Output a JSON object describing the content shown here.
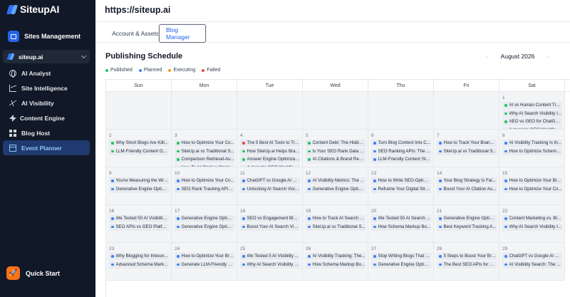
{
  "sidebar": {
    "logo": "SiteupAI",
    "section": "Sites Management",
    "site": "siteup.ai",
    "nav": [
      {
        "label": "AI Analyst",
        "icon": "globe-icon"
      },
      {
        "label": "Site Intelligence",
        "icon": "chart-icon"
      },
      {
        "label": "AI Visibility",
        "icon": "pulse-icon"
      },
      {
        "label": "Content Engine",
        "icon": "bolt-icon"
      },
      {
        "label": "Blog Host",
        "icon": "grid-icon"
      },
      {
        "label": "Event Planner",
        "icon": "calendar-icon",
        "active": true
      }
    ],
    "quick_start": "Quick Start"
  },
  "header": {
    "url": "https://siteup.ai"
  },
  "tabs": [
    {
      "label": "Account & Assets"
    },
    {
      "label": "Blog Manager",
      "active": true
    }
  ],
  "schedule": {
    "title": "Publishing Schedule",
    "month": "August 2026",
    "prev": "‹",
    "next": "›",
    "legend": [
      {
        "label": "Published",
        "color": "#22c55e"
      },
      {
        "label": "Planned",
        "color": "#3b82f6"
      },
      {
        "label": "Executing",
        "color": "#f59e0b"
      },
      {
        "label": "Failed",
        "color": "#ef4444"
      }
    ],
    "weekdays": [
      "Sun",
      "Mon",
      "Tue",
      "Wed",
      "Thu",
      "Fri",
      "Sat"
    ],
    "colors": {
      "published": "#22c55e",
      "planned": "#3b82f6",
      "failed": "#ef4444"
    },
    "weeks": [
      [
        {
          "day": "",
          "events": []
        },
        {
          "day": "",
          "events": []
        },
        {
          "day": "",
          "events": []
        },
        {
          "day": "",
          "events": []
        },
        {
          "day": "",
          "events": []
        },
        {
          "day": "",
          "events": []
        },
        {
          "day": "1",
          "events": [
            {
              "title": "AI vs Human Content Tru...",
              "status": "published"
            },
            {
              "title": "Why AI Search Visibility I...",
              "status": "published"
            },
            {
              "title": "AEO vs GEO for ChatGPT ...",
              "status": "published"
            },
            {
              "title": "Automatic GEO Workflow...",
              "status": "published"
            }
          ]
        }
      ],
      [
        {
          "day": "2",
          "events": [
            {
              "title": "Why Short Blogs Are Killi...",
              "status": "published"
            },
            {
              "title": "LLM-Friendly Content Opt...",
              "status": "published"
            }
          ]
        },
        {
          "day": "3",
          "events": [
            {
              "title": "How to Optimize Your Co...",
              "status": "published"
            },
            {
              "title": "SiteUp.ai vs Traditional S...",
              "status": "published"
            },
            {
              "title": "Comparison Retrieval-Au...",
              "status": "published"
            },
            {
              "title": "How To AI Citation Strate...",
              "status": "published"
            }
          ]
        },
        {
          "day": "4",
          "events": [
            {
              "title": "The 5 Best AI Tools to Tra...",
              "status": "failed"
            },
            {
              "title": "How SiteUp.ai Helps Bran...",
              "status": "published"
            },
            {
              "title": "Answer Engine Optimizati...",
              "status": "published"
            },
            {
              "title": "Automatic GEO Workflow...",
              "status": "published"
            }
          ]
        },
        {
          "day": "5",
          "events": [
            {
              "title": "Content Debt: The Hidden...",
              "status": "published"
            },
            {
              "title": "Is Your SEO Rank Data Ac...",
              "status": "published"
            },
            {
              "title": "AI Citations & Brand Reco...",
              "status": "published"
            }
          ]
        },
        {
          "day": "6",
          "events": [
            {
              "title": "Turn Blog Content Into C...",
              "status": "planned"
            },
            {
              "title": "SEO Ranking APIs: The Hi...",
              "status": "planned"
            },
            {
              "title": "LLM-Friendly Content Stra...",
              "status": "planned"
            }
          ]
        },
        {
          "day": "7",
          "events": [
            {
              "title": "How to Track Your Brand ...",
              "status": "planned"
            },
            {
              "title": "SiteUp.ai vs Traditional S...",
              "status": "planned"
            }
          ]
        },
        {
          "day": "8",
          "events": [
            {
              "title": "AI Visibility Tracking Is th...",
              "status": "planned"
            },
            {
              "title": "How to Optimize Schema...",
              "status": "planned"
            }
          ]
        }
      ],
      [
        {
          "day": "9",
          "events": [
            {
              "title": "You're Measuring the Wro...",
              "status": "planned"
            },
            {
              "title": "Generative Engine Optimi...",
              "status": "planned"
            }
          ]
        },
        {
          "day": "10",
          "events": [
            {
              "title": "How to Optimize Your Co...",
              "status": "planned"
            },
            {
              "title": "SEO Rank Tracking APIs ...",
              "status": "planned"
            }
          ]
        },
        {
          "day": "11",
          "events": [
            {
              "title": "ChatGPT vs Google AI Br...",
              "status": "planned"
            },
            {
              "title": "Unlocking AI Search Visib...",
              "status": "planned"
            }
          ]
        },
        {
          "day": "12",
          "events": [
            {
              "title": "AI Visibility Metrics: The ...",
              "status": "planned"
            },
            {
              "title": "Generative Engine Optimi...",
              "status": "planned"
            }
          ]
        },
        {
          "day": "13",
          "events": [
            {
              "title": "How to Write SEO-Optimi...",
              "status": "planned"
            },
            {
              "title": "Reframe Your Digital Stra...",
              "status": "planned"
            }
          ]
        },
        {
          "day": "14",
          "events": [
            {
              "title": "Your Blog Strategy Is Faili...",
              "status": "planned"
            },
            {
              "title": "Boost Your AI Citation Au...",
              "status": "planned"
            }
          ]
        },
        {
          "day": "15",
          "events": [
            {
              "title": "How to Optimize Your Bra...",
              "status": "planned"
            },
            {
              "title": "How to Optimize Your Co...",
              "status": "planned"
            }
          ]
        }
      ],
      [
        {
          "day": "16",
          "events": [
            {
              "title": "We Tested 50 AI Visibility ...",
              "status": "planned"
            },
            {
              "title": "SEO APIs vs GEO Platfor...",
              "status": "planned"
            }
          ]
        },
        {
          "day": "17",
          "events": [
            {
              "title": "Generative Engine Optimi...",
              "status": "planned"
            },
            {
              "title": "Generative Engine Optimi...",
              "status": "planned"
            }
          ]
        },
        {
          "day": "18",
          "events": [
            {
              "title": "SEO vs Engagement Blog...",
              "status": "planned"
            },
            {
              "title": "Boost Your AI Search Visi...",
              "status": "planned"
            }
          ]
        },
        {
          "day": "19",
          "events": [
            {
              "title": "How to Track AI Search V...",
              "status": "planned"
            },
            {
              "title": "SiteUp.ai vs Traditional S...",
              "status": "planned"
            }
          ]
        },
        {
          "day": "20",
          "events": [
            {
              "title": "We Tested 50 AI Search ...",
              "status": "planned"
            },
            {
              "title": "How Schema Markup Bo...",
              "status": "planned"
            }
          ]
        },
        {
          "day": "21",
          "events": [
            {
              "title": "Generative Engine Optimi...",
              "status": "planned"
            },
            {
              "title": "Best Keyword Tracking A...",
              "status": "planned"
            }
          ]
        },
        {
          "day": "22",
          "events": [
            {
              "title": "Content Marketing vs. Bl...",
              "status": "planned"
            },
            {
              "title": "Why AI Search Visibility I...",
              "status": "planned"
            }
          ]
        }
      ],
      [
        {
          "day": "23",
          "events": [
            {
              "title": "Why Blogging for Inboun...",
              "status": "planned"
            },
            {
              "title": "Advanced Schema Marku...",
              "status": "planned"
            }
          ]
        },
        {
          "day": "24",
          "events": [
            {
              "title": "How to Optimize Your Bra...",
              "status": "planned"
            },
            {
              "title": "Generate LLM-Friendly M...",
              "status": "planned"
            }
          ]
        },
        {
          "day": "25",
          "events": [
            {
              "title": "We Tested 5 AI Visibility ...",
              "status": "planned"
            },
            {
              "title": "Why AI Search Visibility T...",
              "status": "planned"
            }
          ]
        },
        {
          "day": "26",
          "events": [
            {
              "title": "AI Visibility Tracking: The...",
              "status": "planned"
            },
            {
              "title": "How Schema Markup Bo...",
              "status": "planned"
            }
          ]
        },
        {
          "day": "27",
          "events": [
            {
              "title": "Stop Writing Blogs That N...",
              "status": "planned"
            },
            {
              "title": "Generative Engine Optimi...",
              "status": "planned"
            }
          ]
        },
        {
          "day": "28",
          "events": [
            {
              "title": "5 Steps to Boost Your Bra...",
              "status": "planned"
            },
            {
              "title": "The Best SEO APIs for AI ...",
              "status": "planned"
            }
          ]
        },
        {
          "day": "29",
          "events": [
            {
              "title": "ChatGPT vs Google AI Ov...",
              "status": "planned"
            },
            {
              "title": "AI Visibility Search: The ...",
              "status": "planned"
            }
          ]
        }
      ]
    ]
  }
}
